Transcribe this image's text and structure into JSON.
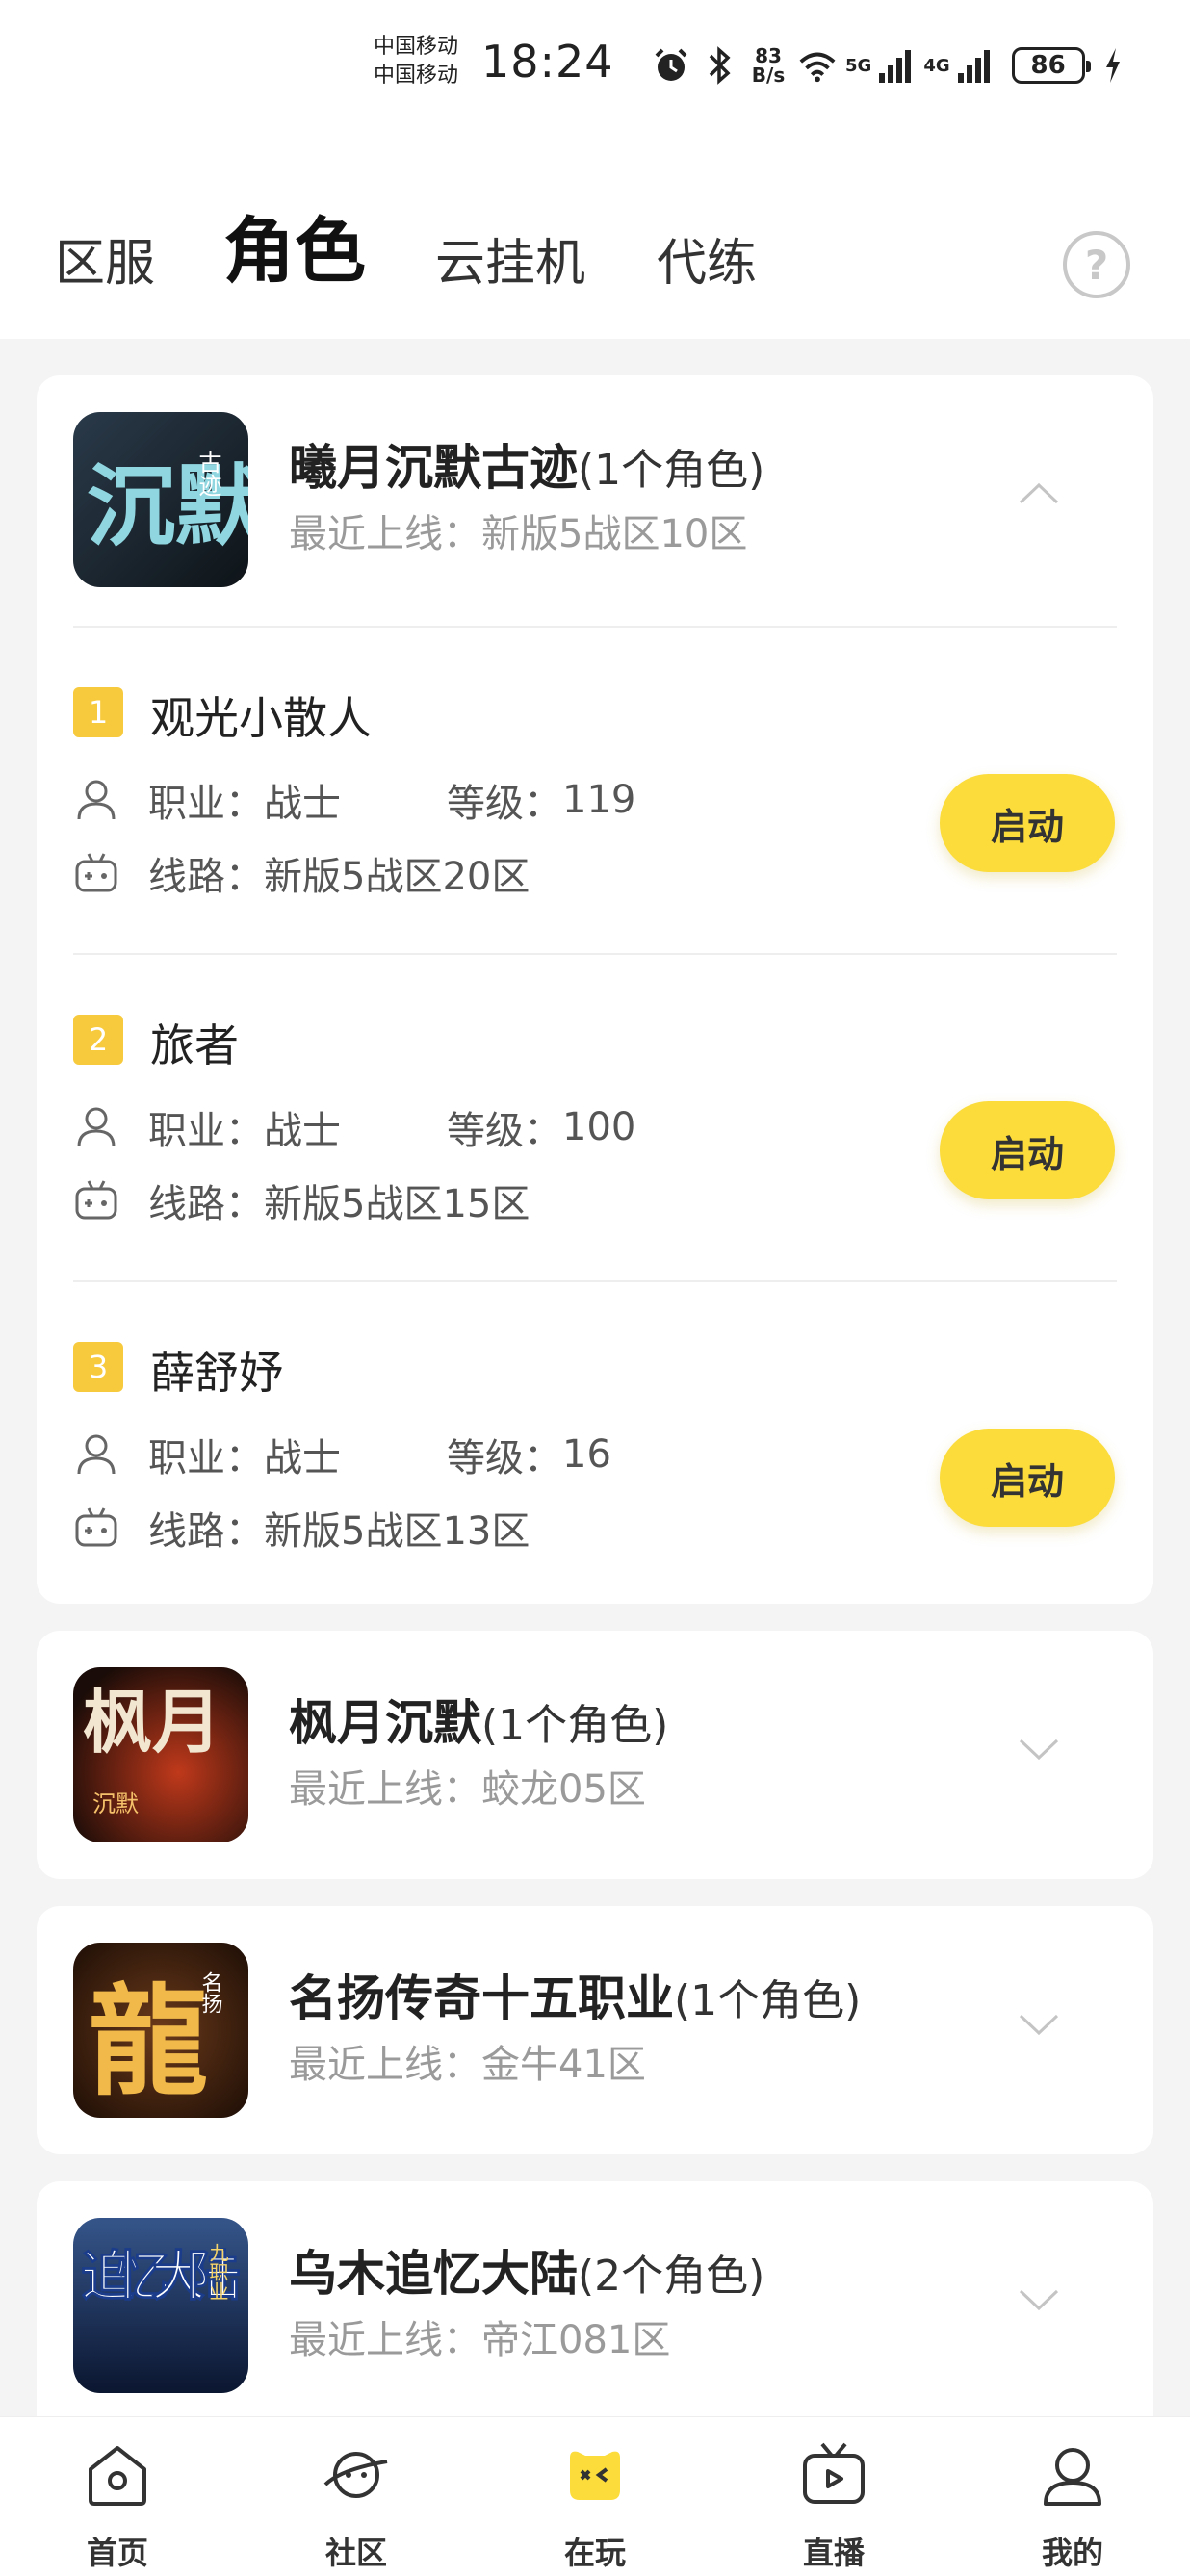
{
  "status_bar": {
    "carrier_1": "中国移动",
    "carrier_2": "中国移动",
    "time": "18:24",
    "net_speed_value": "83",
    "net_speed_unit": "B/s",
    "signal_1": "5G",
    "signal_2": "4G",
    "battery": "86"
  },
  "tabs": {
    "zone": "区服",
    "role": "角色",
    "cloud": "云挂机",
    "train": "代练",
    "help_icon": "question-circle-icon"
  },
  "games": [
    {
      "name": "曦月沉默古迹",
      "count": "(1个角色)",
      "last_online_label": "最近上线：",
      "last_online": "新版5战区10区",
      "icon_text_main": "沉默",
      "icon_text_tag": "古迹",
      "expanded": true,
      "roles": [
        {
          "num": "1",
          "name": "观光小散人",
          "job_label": "职业：",
          "job": "战士",
          "level_label": "等级：",
          "level": "119",
          "route_label": "线路：",
          "route": "新版5战区20区",
          "button": "启动"
        },
        {
          "num": "2",
          "name": "旅者",
          "job_label": "职业：",
          "job": "战士",
          "level_label": "等级：",
          "level": "100",
          "route_label": "线路：",
          "route": "新版5战区15区",
          "button": "启动"
        },
        {
          "num": "3",
          "name": "薛舒妤",
          "job_label": "职业：",
          "job": "战士",
          "level_label": "等级：",
          "level": "16",
          "route_label": "线路：",
          "route": "新版5战区13区",
          "button": "启动"
        }
      ]
    },
    {
      "name": "枫月沉默",
      "count": "(1个角色)",
      "last_online_label": "最近上线：",
      "last_online": "蛟龙05区",
      "icon_text_main": "枫月",
      "icon_text_tag": "沉默",
      "expanded": false
    },
    {
      "name": "名扬传奇十五职业",
      "count": "(1个角色)",
      "last_online_label": "最近上线：",
      "last_online": "金牛41区",
      "icon_text_main": "龍",
      "icon_text_tag": "名扬",
      "expanded": false
    },
    {
      "name": "乌木追忆大陆",
      "count": "(2个角色)",
      "last_online_label": "最近上线：",
      "last_online": "帝江081区",
      "icon_text_main": "追忆大陆",
      "icon_text_tag": "九职业",
      "expanded": false
    }
  ],
  "bottom_nav": [
    {
      "label": "首页",
      "icon": "home-icon"
    },
    {
      "label": "社区",
      "icon": "planet-icon"
    },
    {
      "label": "在玩",
      "icon": "gamepad-icon"
    },
    {
      "label": "直播",
      "icon": "tv-icon"
    },
    {
      "label": "我的",
      "icon": "profile-icon"
    }
  ],
  "colors": {
    "accent_yellow": "#fbdc3a",
    "badge_yellow": "#f7c93d",
    "text_gray": "#9a9a9a",
    "background": "#f4f4f4"
  }
}
